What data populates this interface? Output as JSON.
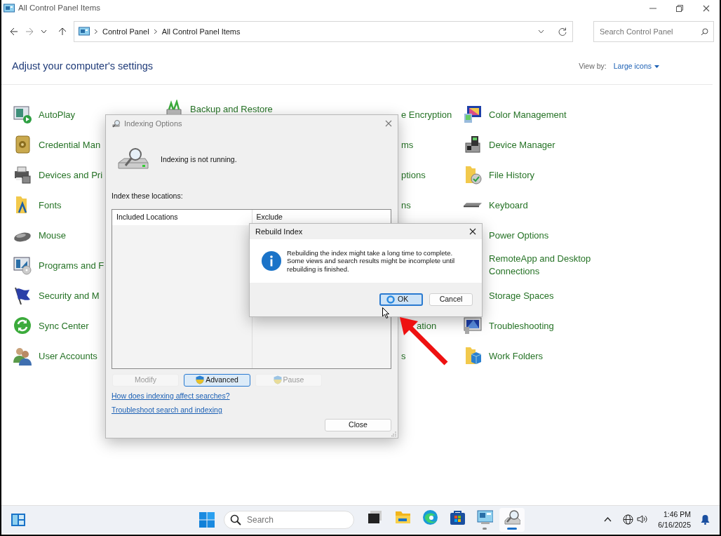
{
  "window": {
    "title": "All Control Panel Items"
  },
  "address_bar": {
    "crumbs": [
      "Control Panel",
      "All Control Panel Items"
    ]
  },
  "search": {
    "placeholder": "Search Control Panel"
  },
  "heading": "Adjust your computer's settings",
  "view_by": {
    "label": "View by:",
    "value": "Large icons"
  },
  "columns": [
    [
      {
        "label": "AutoPlay"
      },
      {
        "label": "Credential Man"
      },
      {
        "label": "Devices and Pri"
      },
      {
        "label": "Fonts"
      },
      {
        "label": "Mouse"
      },
      {
        "label": "Programs and F"
      },
      {
        "label": "Security and M"
      },
      {
        "label": "Sync Center"
      },
      {
        "label": "User Accounts"
      }
    ],
    [
      {
        "label": "Backup and Restore"
      }
    ],
    [
      {
        "label": "e Encryption"
      },
      {
        "label": "ms"
      },
      {
        "label": "ptions"
      },
      {
        "label": "ns"
      },
      {
        "label": "ation"
      },
      {
        "label": "s"
      }
    ],
    [
      {
        "label": "Color Management"
      },
      {
        "label": "Device Manager"
      },
      {
        "label": "File History"
      },
      {
        "label": "Keyboard"
      },
      {
        "label": "Power Options"
      },
      {
        "label": "RemoteApp and Desktop Connections"
      },
      {
        "label": "Storage Spaces"
      },
      {
        "label": "Troubleshooting"
      },
      {
        "label": "Work Folders"
      }
    ]
  ],
  "indexing_dialog": {
    "title": "Indexing Options",
    "status": "Indexing is not running.",
    "locations_label": "Index these locations:",
    "list_columns": [
      "Included Locations",
      "Exclude"
    ],
    "buttons": [
      {
        "label": "Modify",
        "kind": "plain",
        "disabled": true,
        "default": false
      },
      {
        "label": "Advanced",
        "kind": "shield",
        "disabled": false,
        "default": true
      },
      {
        "label": "Pause",
        "kind": "shield",
        "disabled": true,
        "default": false
      }
    ],
    "links": [
      "How does indexing affect searches?",
      "Troubleshoot search and indexing"
    ],
    "close_button": "Close"
  },
  "rebuild_dialog": {
    "title": "Rebuild Index",
    "message": "Rebuilding the index might take a long time to complete.\nSome views and search results might be incomplete until\nrebuilding is finished.",
    "buttons": [
      {
        "label": "OK",
        "selected": true
      },
      {
        "label": "Cancel",
        "selected": false
      }
    ]
  },
  "taskbar": {
    "search_placeholder": "Search",
    "apps": [
      {
        "running": false,
        "active": false
      },
      {
        "running": false,
        "active": false
      },
      {
        "running": false,
        "active": false
      },
      {
        "running": false,
        "active": false
      },
      {
        "running": true,
        "active": false
      },
      {
        "running": true,
        "active": true
      }
    ],
    "clock": {
      "time": "1:46 PM",
      "date": "6/16/2025"
    }
  }
}
